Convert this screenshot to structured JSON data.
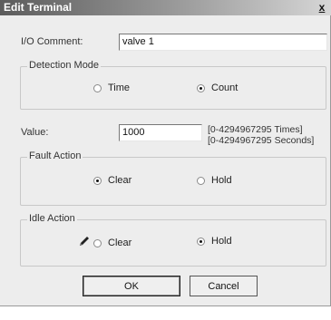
{
  "window": {
    "title": "Edit Terminal",
    "close": "x"
  },
  "io_comment": {
    "label": "I/O Comment:",
    "value": "valve 1"
  },
  "detection_mode": {
    "title": "Detection Mode",
    "options": [
      "Time",
      "Count"
    ],
    "selected": "Count"
  },
  "value_field": {
    "label": "Value:",
    "value": "1000",
    "range_times": "[0-4294967295 Times]",
    "range_seconds": "[0-4294967295 Seconds]"
  },
  "fault_action": {
    "title": "Fault Action",
    "options": [
      "Clear",
      "Hold"
    ],
    "selected": "Clear"
  },
  "idle_action": {
    "title": "Idle Action",
    "options": [
      "Clear",
      "Hold"
    ],
    "selected": "Hold",
    "icon": "pencil-icon"
  },
  "buttons": {
    "ok": "OK",
    "cancel": "Cancel"
  }
}
